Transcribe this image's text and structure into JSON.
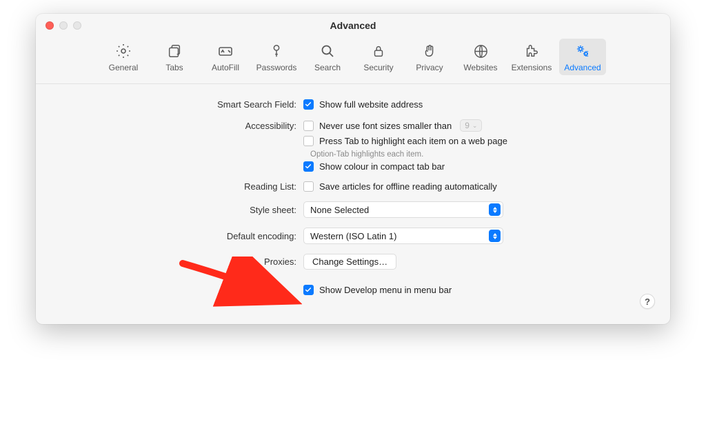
{
  "window": {
    "title": "Advanced"
  },
  "toolbar": [
    {
      "id": "general",
      "label": "General"
    },
    {
      "id": "tabs",
      "label": "Tabs"
    },
    {
      "id": "autofill",
      "label": "AutoFill"
    },
    {
      "id": "passwords",
      "label": "Passwords"
    },
    {
      "id": "search",
      "label": "Search"
    },
    {
      "id": "security",
      "label": "Security"
    },
    {
      "id": "privacy",
      "label": "Privacy"
    },
    {
      "id": "websites",
      "label": "Websites"
    },
    {
      "id": "extensions",
      "label": "Extensions"
    },
    {
      "id": "advanced",
      "label": "Advanced",
      "active": true
    }
  ],
  "sections": {
    "smartSearch": {
      "label": "Smart Search Field:",
      "showFullAddress": {
        "text": "Show full website address",
        "checked": true
      }
    },
    "accessibility": {
      "label": "Accessibility:",
      "neverSmaller": {
        "text": "Never use font sizes smaller than",
        "checked": false,
        "value": "9"
      },
      "pressTab": {
        "text": "Press Tab to highlight each item on a web page",
        "checked": false
      },
      "hint": "Option-Tab highlights each item.",
      "showColour": {
        "text": "Show colour in compact tab bar",
        "checked": true
      }
    },
    "readingList": {
      "label": "Reading List:",
      "saveOffline": {
        "text": "Save articles for offline reading automatically",
        "checked": false
      }
    },
    "styleSheet": {
      "label": "Style sheet:",
      "value": "None Selected"
    },
    "defaultEncoding": {
      "label": "Default encoding:",
      "value": "Western (ISO Latin 1)"
    },
    "proxies": {
      "label": "Proxies:",
      "button": "Change Settings…"
    },
    "develop": {
      "label": "",
      "showDevelop": {
        "text": "Show Develop menu in menu bar",
        "checked": true
      }
    }
  },
  "help": "?"
}
